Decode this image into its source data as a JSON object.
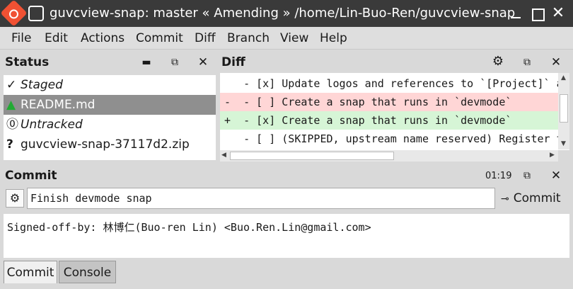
{
  "window": {
    "title": "guvcview-snap: master « Amending » /home/Lin-Buo-Ren/guvcview-snap",
    "close_glyph": "✕"
  },
  "menubar": {
    "items": [
      {
        "label": "File"
      },
      {
        "label": "Edit"
      },
      {
        "label": "Actions"
      },
      {
        "label": "Commit"
      },
      {
        "label": "Diff"
      },
      {
        "label": "Branch"
      },
      {
        "label": "View"
      },
      {
        "label": "Help"
      }
    ]
  },
  "status_panel": {
    "title": "Status",
    "rows": [
      {
        "icon": "✓",
        "label": "Staged"
      },
      {
        "icon": "▲",
        "label": "README.md"
      },
      {
        "icon": "⓪",
        "label": "Untracked"
      },
      {
        "icon": "?",
        "label": "guvcview-snap-37117d2.zip"
      }
    ],
    "colors": {
      "modified_icon": "#22aa33",
      "selected_bg": "#8f8f8f"
    }
  },
  "diff_panel": {
    "title": "Diff",
    "lines": [
      {
        "prefix": " ",
        "text": "  - [x] Update logos and references to `[Project]` and"
      },
      {
        "prefix": "-",
        "text": "  - [ ] Create a snap that runs in `devmode`"
      },
      {
        "prefix": "+",
        "text": "  - [x] Create a snap that runs in `devmode`"
      },
      {
        "prefix": " ",
        "text": "  - [ ] (SKIPPED, upstream name reserved) Register the"
      }
    ]
  },
  "commit_panel": {
    "title": "Commit",
    "time": "01:19",
    "summary": "Finish devmode snap",
    "commit_label": "Commit",
    "message": "Signed-off-by: 林博仁(Buo-ren Lin) <Buo.Ren.Lin@gmail.com>"
  },
  "bottom_tabs": [
    {
      "label": "Commit"
    },
    {
      "label": "Console"
    }
  ]
}
